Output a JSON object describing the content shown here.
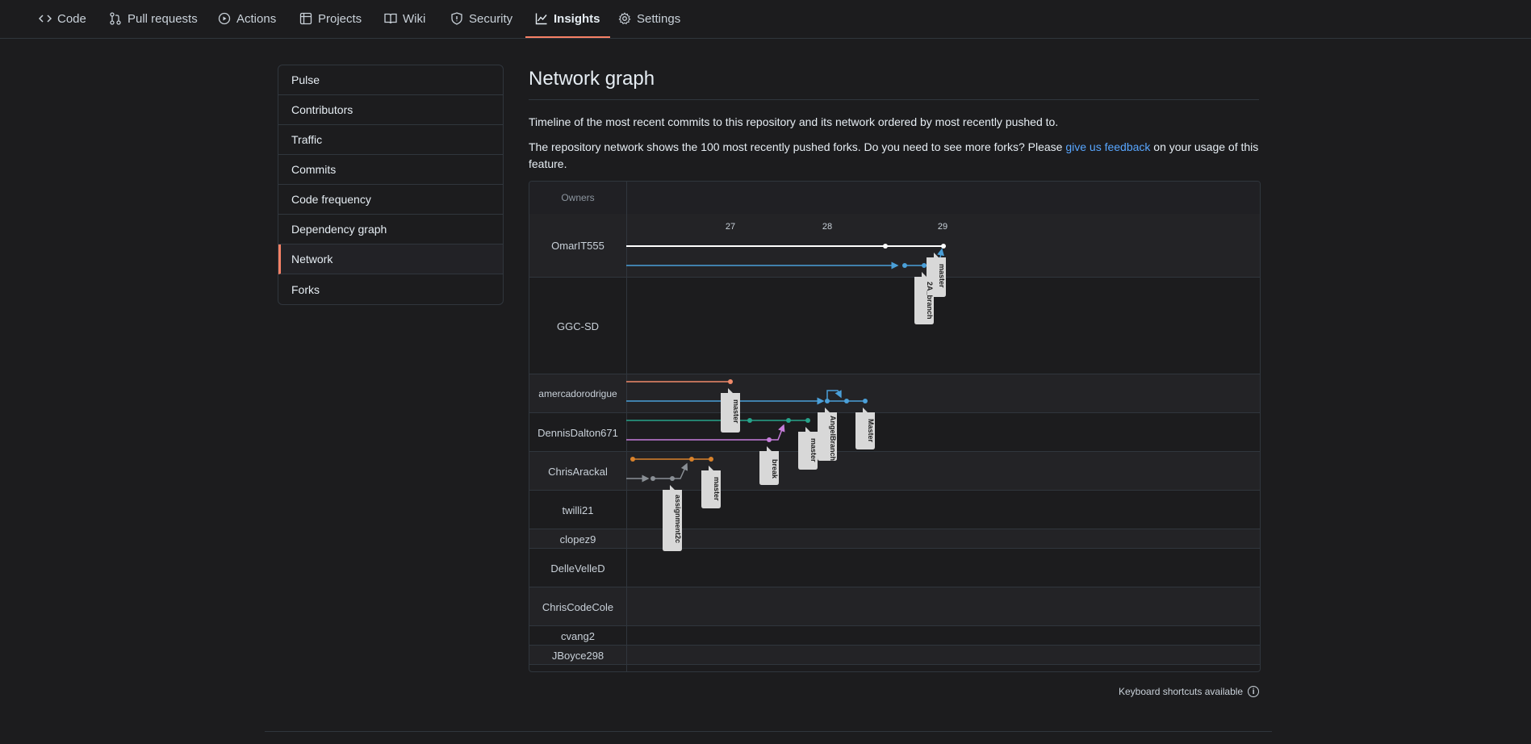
{
  "nav": {
    "tabs": [
      {
        "label": "Code",
        "icon": "code-icon"
      },
      {
        "label": "Pull requests",
        "icon": "pull-request-icon"
      },
      {
        "label": "Actions",
        "icon": "play-icon"
      },
      {
        "label": "Projects",
        "icon": "table-icon"
      },
      {
        "label": "Wiki",
        "icon": "book-icon"
      },
      {
        "label": "Security",
        "icon": "shield-icon"
      },
      {
        "label": "Insights",
        "icon": "graph-icon"
      },
      {
        "label": "Settings",
        "icon": "gear-icon"
      }
    ],
    "selected": "Insights"
  },
  "sidebar": {
    "items": [
      "Pulse",
      "Contributors",
      "Traffic",
      "Commits",
      "Code frequency",
      "Dependency graph",
      "Network",
      "Forks"
    ],
    "selected": "Network"
  },
  "main": {
    "title": "Network graph",
    "desc1": "Timeline of the most recent commits to this repository and its network ordered by most recently pushed to.",
    "desc2_pre": "The repository network shows the 100 most recently pushed forks. Do you need to see more forks? Please ",
    "desc2_link": "give us feedback",
    "desc2_post": " on your usage of this feature."
  },
  "graph": {
    "owners_label": "Owners",
    "dates": [
      "27",
      "28",
      "29"
    ],
    "owners": [
      "OmarIT555",
      "GGC-SD",
      "amercadorodrigue",
      "DennisDalton671",
      "ChrisArackal",
      "twilli21",
      "clopez9",
      "DelleVelleD",
      "ChrisCodeCole",
      "cvang2",
      "JBoyce298"
    ],
    "branch_labels": [
      "master",
      "2A_branch",
      "master",
      "AngelBranch",
      "Master",
      "master",
      "break",
      "master",
      "assignment2c"
    ],
    "colors": {
      "white": "#ffffff",
      "blue": "#4a9fd8",
      "salmon": "#f08a6a",
      "teal": "#27a38a",
      "violet": "#c77ddb",
      "orange": "#d9822b",
      "gray": "#8a8f95"
    }
  },
  "footer": {
    "shortcuts": "Keyboard shortcuts available",
    "info_glyph": "i"
  }
}
